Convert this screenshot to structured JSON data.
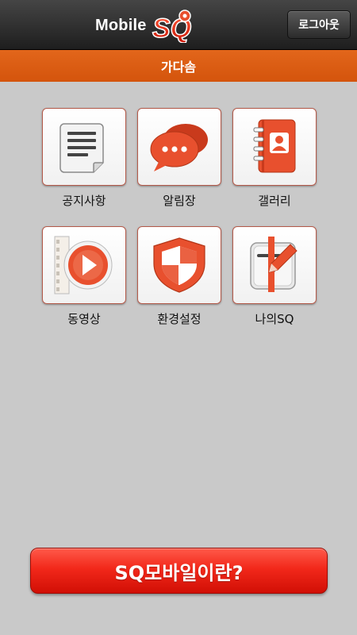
{
  "header": {
    "brand_text": "Mobile",
    "logo_text": "SQ",
    "logout_label": "로그아웃"
  },
  "org_bar": {
    "title": "가다솜"
  },
  "menu": [
    {
      "label": "공지사항",
      "icon": "notice-document-icon"
    },
    {
      "label": "알림장",
      "icon": "chat-bubbles-icon"
    },
    {
      "label": "갤러리",
      "icon": "address-book-icon"
    },
    {
      "label": "동영상",
      "icon": "video-play-icon"
    },
    {
      "label": "환경설정",
      "icon": "shield-icon"
    },
    {
      "label": "나의SQ",
      "icon": "edit-pen-icon"
    }
  ],
  "cta": {
    "label": "SQ모바일이란?"
  },
  "colors": {
    "accent_orange": "#e0601a",
    "icon_red": "#e8502e",
    "cta_red": "#f2281a",
    "background": "#c9c9c9"
  }
}
